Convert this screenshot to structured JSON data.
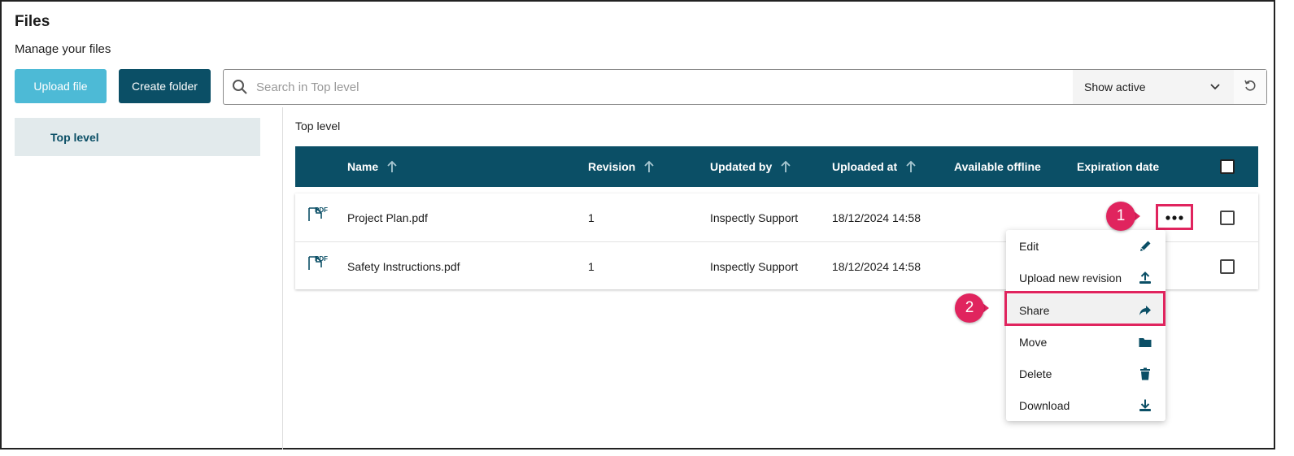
{
  "header": {
    "title": "Files",
    "subtitle": "Manage your files"
  },
  "toolbar": {
    "upload_label": "Upload file",
    "create_folder_label": "Create folder",
    "search_placeholder": "Search in Top level",
    "filter_value": "Show active"
  },
  "sidebar": {
    "items": [
      {
        "label": "Top level",
        "selected": true
      }
    ]
  },
  "breadcrumb": "Top level",
  "table": {
    "columns": [
      "Name",
      "Revision",
      "Updated by",
      "Uploaded at",
      "Available offline",
      "Expiration date"
    ],
    "rows": [
      {
        "icon": "pdf-file-icon",
        "icon_label": "PDF",
        "name": "Project Plan.pdf",
        "revision": "1",
        "updated_by": "Inspectly Support",
        "uploaded_at": "18/12/2024 14:58",
        "available_offline": "",
        "expiration_date": ""
      },
      {
        "icon": "pdf-file-icon",
        "icon_label": "PDF",
        "name": "Safety Instructions.pdf",
        "revision": "1",
        "updated_by": "Inspectly Support",
        "uploaded_at": "18/12/2024 14:58",
        "available_offline": "",
        "expiration_date": ""
      }
    ]
  },
  "context_menu": {
    "items": [
      {
        "label": "Edit",
        "icon": "pencil-icon"
      },
      {
        "label": "Upload new revision",
        "icon": "upload-icon"
      },
      {
        "label": "Share",
        "icon": "share-icon"
      },
      {
        "label": "Move",
        "icon": "folder-icon"
      },
      {
        "label": "Delete",
        "icon": "trash-icon"
      },
      {
        "label": "Download",
        "icon": "download-icon"
      }
    ]
  },
  "callouts": [
    "1",
    "2"
  ],
  "colors": {
    "primary": "#0b4f66",
    "accent": "#4dbad6",
    "highlight": "#e0245e",
    "sidebar_selected": "#e2eaec"
  }
}
